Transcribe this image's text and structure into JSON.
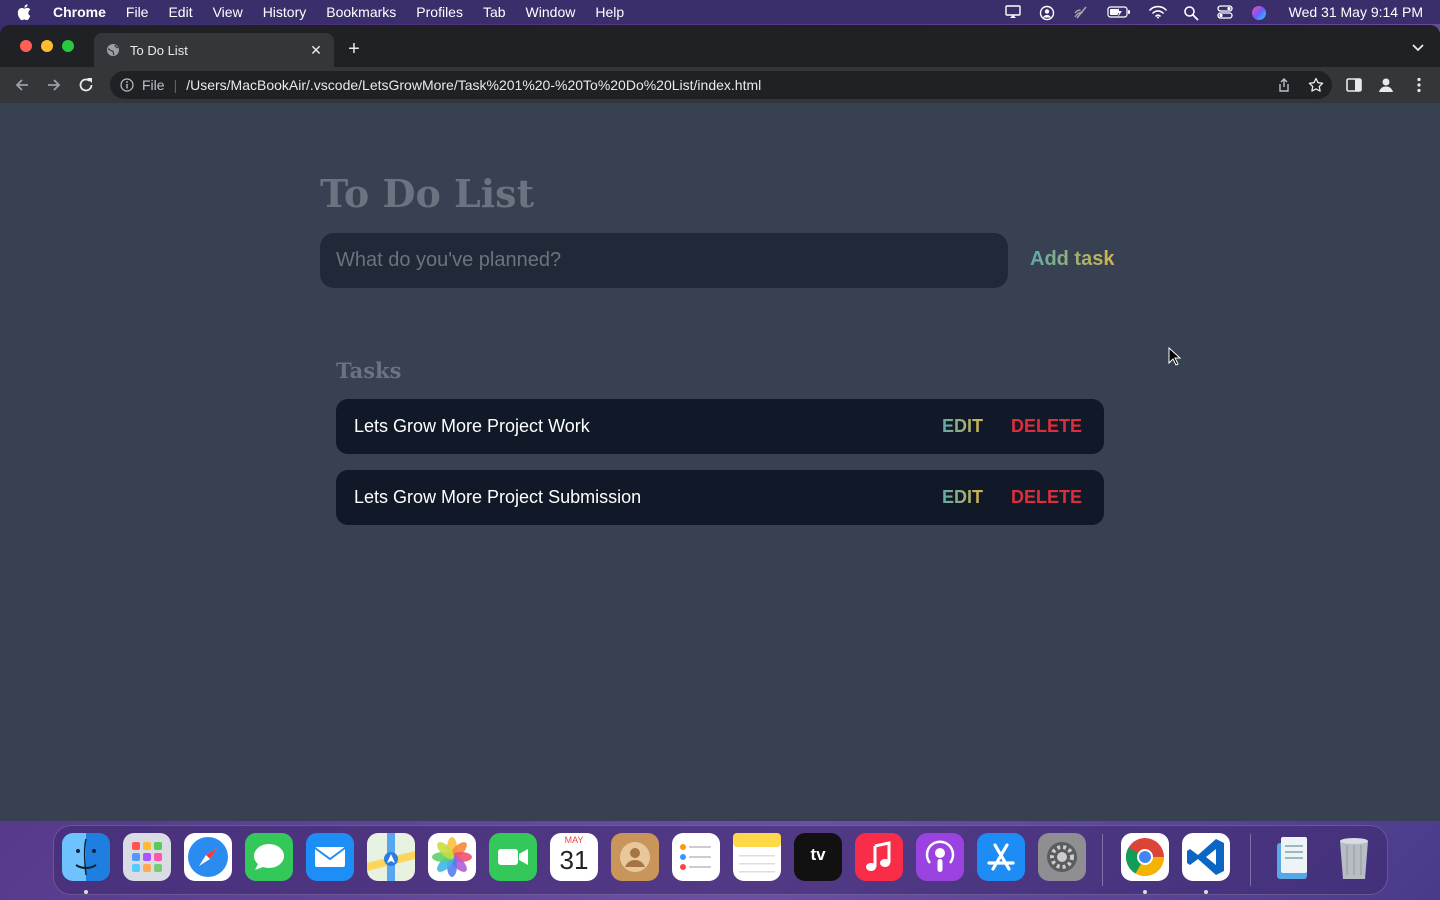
{
  "menubar": {
    "app_name": "Chrome",
    "items": [
      "File",
      "Edit",
      "View",
      "History",
      "Bookmarks",
      "Profiles",
      "Tab",
      "Window",
      "Help"
    ],
    "clock": "Wed 31 May  9:14 PM"
  },
  "browser": {
    "tab_title": "To Do List",
    "address_scheme": "File",
    "address_url": "/Users/MacBookAir/.vscode/LetsGrowMore/Task%201%20-%20To%20Do%20List/index.html"
  },
  "app": {
    "title": "To Do List",
    "input_placeholder": "What do you've planned?",
    "input_value": "",
    "add_button": "Add task",
    "tasks_heading": "Tasks",
    "tasks": [
      {
        "text": "Lets Grow More Project Work",
        "edit": "EDIT",
        "delete": "DELETE"
      },
      {
        "text": "Lets Grow More Project Submission",
        "edit": "EDIT",
        "delete": "DELETE"
      }
    ]
  },
  "dock": {
    "calendar_month": "MAY",
    "calendar_day": "31",
    "tv_label": "tv",
    "apps": [
      "finder-icon",
      "launchpad-icon",
      "safari-icon",
      "messages-icon",
      "mail-icon",
      "maps-icon",
      "photos-icon",
      "facetime-icon",
      "calendar-icon",
      "contacts-icon",
      "reminders-icon",
      "notes-icon",
      "apple-tv-icon",
      "music-icon",
      "podcasts-icon",
      "app-store-icon",
      "system-settings-icon",
      "chrome-icon",
      "vscode-icon",
      "downloads-stack-icon",
      "trash-icon"
    ]
  },
  "colors": {
    "page_bg": "#374151",
    "input_bg": "#1f2937",
    "task_bg": "#111827",
    "delete_red": "#dc2f3c",
    "gradient_start": "#5eaaa8",
    "gradient_end": "#d4b44a"
  }
}
